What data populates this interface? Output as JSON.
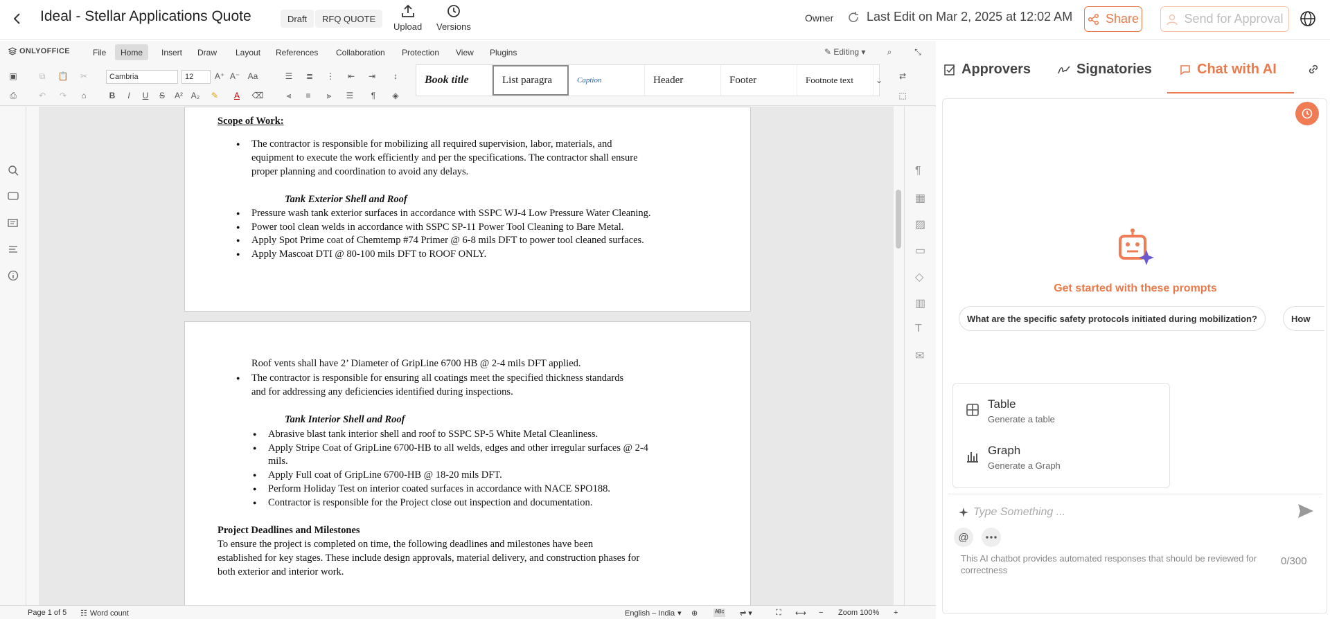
{
  "header": {
    "title": "Ideal - Stellar Applications Quote",
    "status_badge": "Draft",
    "type_badge": "RFQ QUOTE",
    "upload_label": "Upload",
    "versions_label": "Versions",
    "role": "Owner",
    "last_edit": "Last Edit on Mar 2, 2025 at 12:02 AM",
    "share_label": "Share",
    "approval_label": "Send for Approval"
  },
  "editor": {
    "brand": "ONLYOFFICE",
    "menu": [
      "File",
      "Home",
      "Insert",
      "Draw",
      "Layout",
      "References",
      "Collaboration",
      "Protection",
      "View",
      "Plugins"
    ],
    "active_menu": "Home",
    "mode": "Editing",
    "font": "Cambria",
    "font_size": "12",
    "styles": [
      "Book title",
      "List paragra",
      "Caption",
      "Header",
      "Footer",
      "Footnote text"
    ],
    "status": {
      "page": "Page 1 of 5",
      "word_count": "Word count",
      "language": "English – India",
      "zoom": "Zoom 100%"
    }
  },
  "document": {
    "page1": {
      "scope_heading": "Scope of Work:",
      "scope_lines": [
        "The contractor is responsible for mobilizing all required supervision, labor, materials, and",
        "equipment to execute the work efficiently and per the specifications. The contractor shall ensure",
        "proper planning and coordination to avoid any delays."
      ],
      "ext_heading": "Tank Exterior Shell and Roof",
      "ext_items": [
        "Pressure wash tank exterior surfaces in accordance with SSPC WJ-4 Low Pressure Water Cleaning.",
        "Power tool clean welds in accordance with SSPC SP-11 Power Tool Cleaning to Bare Metal.",
        "Apply Spot Prime coat of Chemtemp #74 Primer @ 6-8 mils DFT to power tool cleaned surfaces.",
        "Apply Mascoat DTI @ 80-100 mils DFT to ROOF ONLY."
      ]
    },
    "page2": {
      "roof_vents": "Roof vents shall have 2’ Diameter of GripLine 6700 HB @ 2-4 mils DFT applied.",
      "coatings_lines": [
        "The contractor is responsible for ensuring all coatings meet the specified thickness standards",
        "and for addressing any deficiencies identified during inspections."
      ],
      "int_heading": "Tank Interior Shell and Roof",
      "int_items": [
        "Abrasive blast tank interior shell and roof to SSPC SP-5 White Metal Cleanliness.",
        "Apply Stripe Coat of GripLine 6700-HB to all welds, edges and other irregular surfaces @ 2-4",
        "mils.",
        "Apply Full coat of GripLine 6700-HB @ 18-20 mils DFT.",
        "Perform Holiday Test on interior coated surfaces in accordance with NACE SPO188.",
        "Contractor is responsible for the Project close out inspection and documentation."
      ],
      "deadlines_heading": "Project Deadlines and Milestones",
      "deadlines_lines": [
        "To ensure the project is completed on time, the following deadlines and milestones have been",
        "established for key stages. These include design approvals, material delivery, and construction phases for",
        "both exterior and interior work."
      ]
    }
  },
  "panel": {
    "tabs": [
      "Approvers",
      "Signatories",
      "Chat with AI"
    ],
    "active_tab": "Chat with AI",
    "get_started": "Get started with these prompts",
    "prompts": [
      "What are the specific safety protocols initiated during mobilization?",
      "How"
    ],
    "menu": [
      {
        "title": "Table",
        "subtitle": "Generate a table"
      },
      {
        "title": "Graph",
        "subtitle": "Generate a Graph"
      }
    ],
    "input_placeholder": "Type Something ...",
    "disclaimer": "This AI chatbot provides automated responses that should be reviewed for correctness",
    "char_count": "0/300"
  },
  "colors": {
    "accent": "#ea7a4a",
    "accent_light": "#f3c6b0"
  }
}
